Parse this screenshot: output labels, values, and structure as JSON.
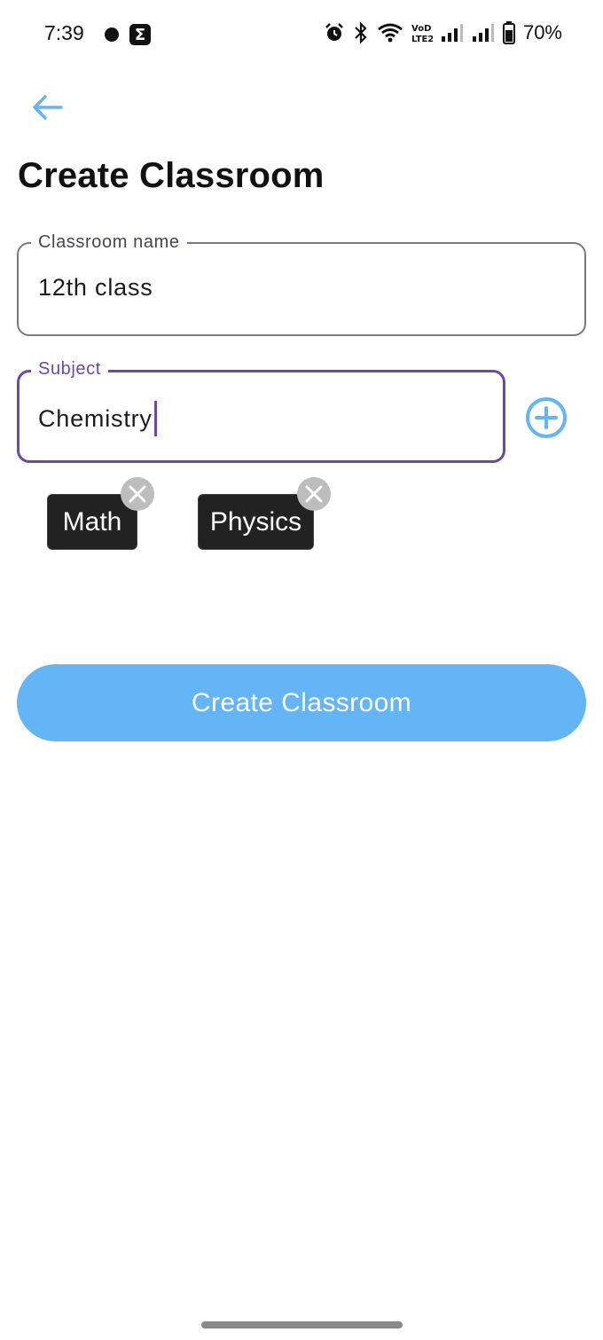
{
  "status_bar": {
    "time": "7:39",
    "battery": "70%",
    "left_icons": [
      "notification-dot-icon",
      "sigma-app-icon"
    ],
    "right_icons": [
      "alarm-icon",
      "bluetooth-icon",
      "wifi-icon",
      "volte-icon",
      "signal-icon",
      "signal-icon",
      "battery-icon"
    ]
  },
  "header": {
    "back_icon": "arrow-left-icon",
    "title": "Create Classroom"
  },
  "form": {
    "classroom_name": {
      "label": "Classroom name",
      "value": "12th class"
    },
    "subject": {
      "label": "Subject",
      "value": "Chemistry",
      "add_icon": "add-circle-icon"
    },
    "chips": [
      {
        "label": "Math"
      },
      {
        "label": "Physics"
      }
    ],
    "submit_label": "Create Classroom"
  },
  "colors": {
    "accent_blue": "#64b5f6",
    "focus_purple": "#6b4ba1",
    "chip_bg": "#222222",
    "chip_remove_bg": "#bdbdbd"
  }
}
